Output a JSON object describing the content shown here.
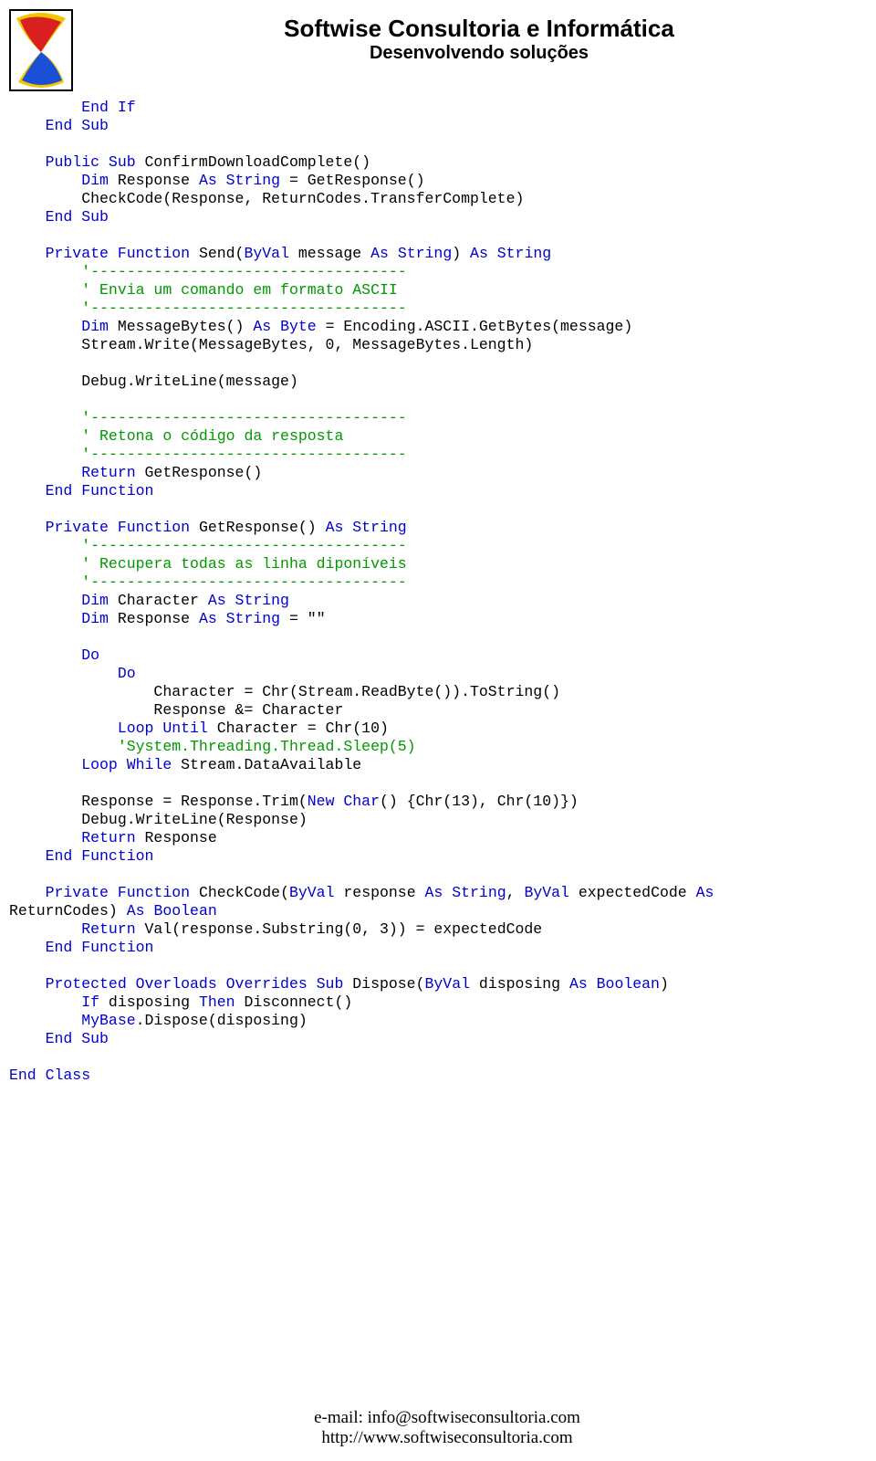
{
  "header": {
    "company": "Softwise Consultoria e Informática",
    "tagline": "Desenvolvendo soluções"
  },
  "footer": {
    "email_line": "e-mail: info@softwiseconsultoria.com",
    "url_line": "http://www.softwiseconsultoria.com"
  },
  "code": {
    "t01a": "        End If",
    "t01b": "    End Sub",
    "t02a": "    Public Sub",
    "t02b": " ConfirmDownloadComplete()",
    "t03a": "        Dim",
    "t03b": " Response ",
    "t03c": "As String",
    "t03d": " = GetResponse()",
    "t04": "        CheckCode(Response, ReturnCodes.TransferComplete)",
    "t05": "    End Sub",
    "t06a": "    Private Function",
    "t06b": " Send(",
    "t06c": "ByVal",
    "t06d": " message ",
    "t06e": "As String",
    "t06f": ") ",
    "t06g": "As String",
    "t07": "        '-----------------------------------",
    "t08": "        ' Envia um comando em formato ASCII",
    "t09": "        '-----------------------------------",
    "t10a": "        Dim",
    "t10b": " MessageBytes() ",
    "t10c": "As Byte",
    "t10d": " = Encoding.ASCII.GetBytes(message)",
    "t11": "        Stream.Write(MessageBytes, 0, MessageBytes.Length)",
    "t12": "        Debug.WriteLine(message)",
    "t13": "        '-----------------------------------",
    "t14": "        ' Retona o código da resposta",
    "t15": "        '-----------------------------------",
    "t16a": "        Return",
    "t16b": " GetResponse()",
    "t17": "    End Function",
    "t18a": "    Private Function",
    "t18b": " GetResponse() ",
    "t18c": "As String",
    "t19": "        '-----------------------------------",
    "t20": "        ' Recupera todas as linha diponíveis",
    "t21": "        '-----------------------------------",
    "t22a": "        Dim",
    "t22b": " Character ",
    "t22c": "As String",
    "t23a": "        Dim",
    "t23b": " Response ",
    "t23c": "As String",
    "t23d": " = ",
    "t23e": "\"\"",
    "t24": "        Do",
    "t25": "            Do",
    "t26": "                Character = Chr(Stream.ReadByte()).ToString()",
    "t27": "                Response &= Character",
    "t28a": "            Loop Until",
    "t28b": " Character = Chr(10)",
    "t29": "            'System.Threading.Thread.Sleep(5)",
    "t30a": "        Loop While",
    "t30b": " Stream.DataAvailable",
    "t31a": "        Response = Response.Trim(",
    "t31b": "New Char",
    "t31c": "() {Chr(13), Chr(10)})",
    "t32": "        Debug.WriteLine(Response)",
    "t33a": "        Return",
    "t33b": " Response",
    "t34": "    End Function",
    "t35a": "    Private Function",
    "t35b": " CheckCode(",
    "t35c": "ByVal",
    "t35d": " response ",
    "t35e": "As String",
    "t35f": ", ",
    "t35g": "ByVal",
    "t35h": " expectedCode ",
    "t35i": "As",
    "t35j": " ",
    "t35k": "ReturnCodes) ",
    "t35l": "As Boolean",
    "t36a": "        Return",
    "t36b": " Val(response.Substring(0, 3)) = expectedCode",
    "t37": "    End Function",
    "t38a": "    Protected Overloads Overrides Sub",
    "t38b": " Dispose(",
    "t38c": "ByVal",
    "t38d": " disposing ",
    "t38e": "As Boolean",
    "t38f": ")",
    "t39a": "        If",
    "t39b": " disposing ",
    "t39c": "Then",
    "t39d": " Disconnect()",
    "t40a": "        MyBase",
    "t40b": ".Dispose(disposing)",
    "t41": "    End Sub",
    "t42": "End Class"
  }
}
